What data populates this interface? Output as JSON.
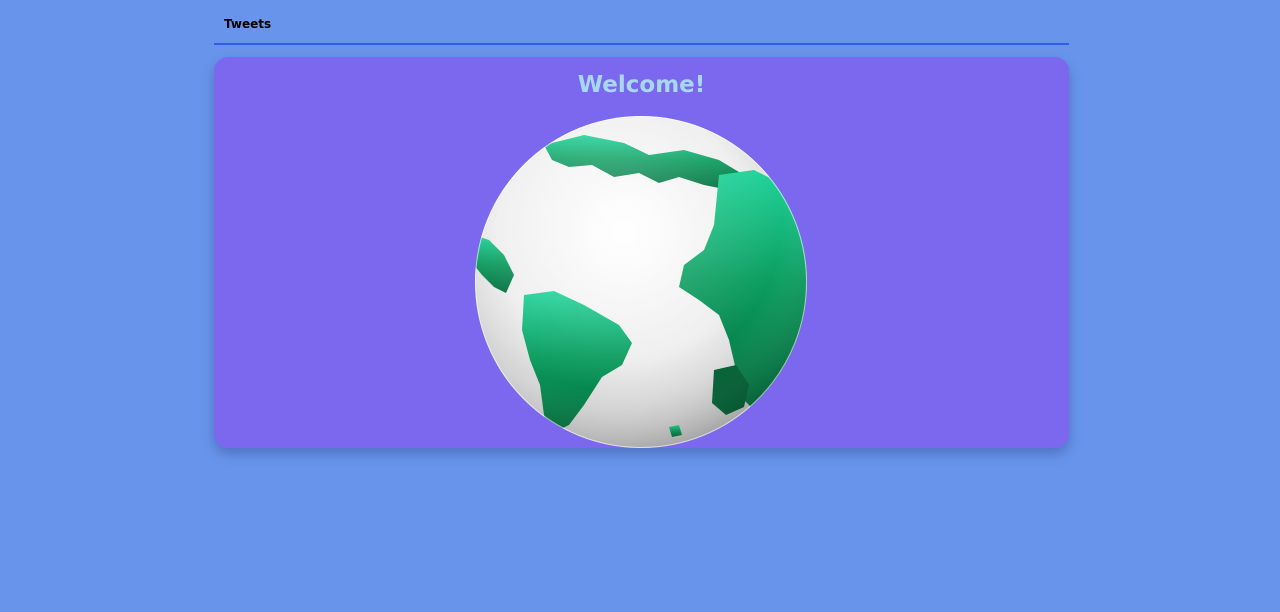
{
  "nav": {
    "tweets_label": "Tweets"
  },
  "card": {
    "title": "Welcome!",
    "image_icon": "globe-icon"
  },
  "colors": {
    "page_background": "#6895eb",
    "card_background": "#7b68ee",
    "title_text": "#a8d8f0",
    "nav_border": "#2f5de8",
    "globe_land": "#0f9a5e",
    "globe_ocean": "#f2f2f2"
  }
}
